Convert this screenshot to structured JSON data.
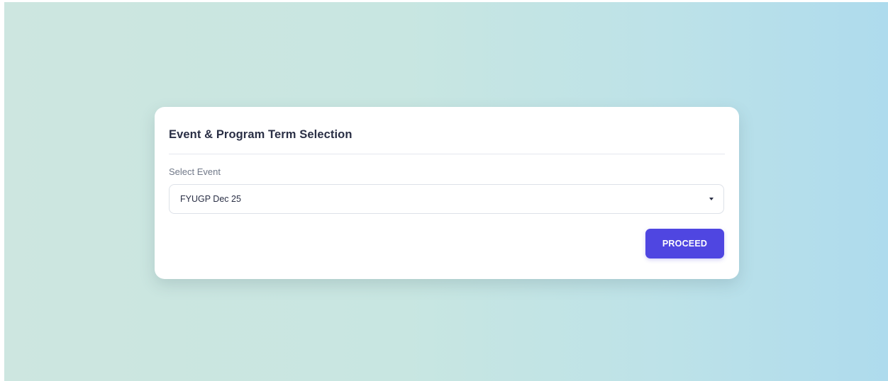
{
  "card": {
    "title": "Event & Program Term Selection",
    "event_label": "Select Event",
    "event_selected": "FYUGP Dec 25",
    "proceed_label": "PROCEED"
  },
  "colors": {
    "primary": "#4f46e1",
    "background_start": "#cde6e0",
    "background_end": "#aedbed"
  }
}
